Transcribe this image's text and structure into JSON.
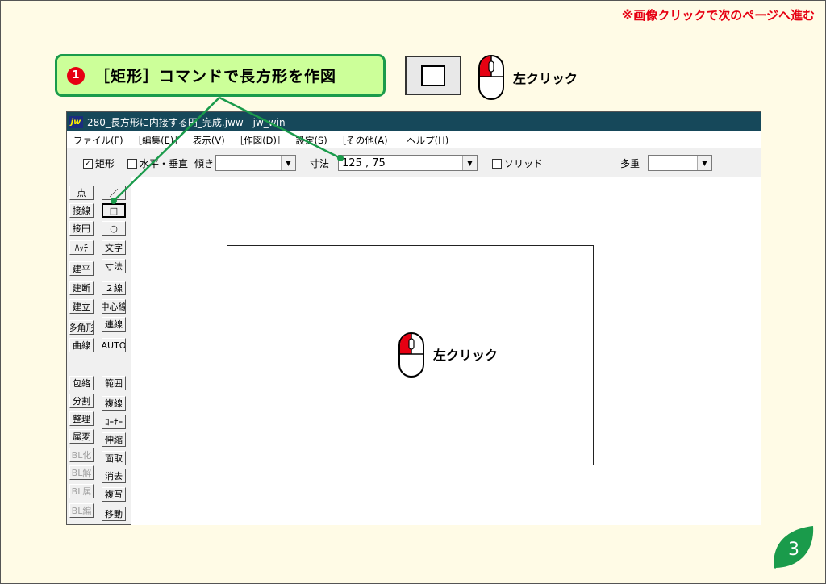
{
  "nav_hint": "※画像クリックで次のページへ進む",
  "step": {
    "number": "1",
    "text": "［矩形］コマンドで長方形を作図"
  },
  "left_click_label_top": "左クリック",
  "left_click_label_canvas": "左クリック",
  "page_number": "3",
  "window": {
    "title": "280_長方形に内接する円_完成.jww - jw_win",
    "icon_text": "jw",
    "menu": [
      "ファイル(F)",
      "［編集(E)］",
      "表示(V)",
      "［作図(D)］",
      "設定(S)",
      "［その他(A)］",
      "ヘルプ(H)"
    ],
    "toolbar": {
      "rect_check": "✓",
      "rect_label": "矩形",
      "hv_label": "水平・垂直",
      "tilt_label": "傾き",
      "tilt_value": "",
      "dim_label": "寸法",
      "dim_value": "125 , 75",
      "solid_label": "ソリッド",
      "multi_label": "多重",
      "multi_value": ""
    },
    "tools_left": [
      "点",
      "接線",
      "接円",
      "ﾊｯﾁ",
      "建平",
      "建断",
      "建立",
      "多角形",
      "曲線",
      "包絡",
      "分割",
      "整理",
      "属変",
      "BL化",
      "BL解",
      "BL属",
      "BL編"
    ],
    "tools_right": [
      "／",
      "□",
      "○",
      "文字",
      "寸法",
      "２線",
      "中心線",
      "連線",
      "AUTO",
      "範囲",
      "複線",
      "ｺｰﾅｰ",
      "伸縮",
      "面取",
      "消去",
      "複写",
      "移動"
    ]
  },
  "colors": {
    "accent_red": "#e60012",
    "callout_green": "#1a9b4b",
    "callout_fill": "#ccff99",
    "title_bar": "#16485a"
  }
}
